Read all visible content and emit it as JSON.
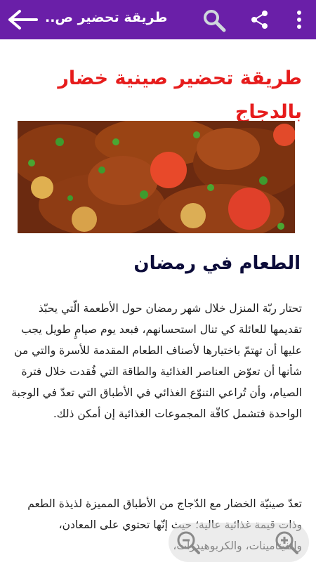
{
  "appbar": {
    "title": "طريقة تحضير ص..",
    "back_icon": "arrow-back-icon",
    "search_icon": "search-icon",
    "share_icon": "share-icon",
    "more_icon": "more-vert-icon",
    "color": "#6a1fa8"
  },
  "article": {
    "title": "طريقة تحضير صينية خضار بالدجاج",
    "title_color": "#e61c1c",
    "section_title": "الطعام في رمضان",
    "paragraph_1": "تحتار ربّة المنزل خلال شهر رمضان حول الأطعمة الّتي يحبّذ تقديمها للعائلة كي تنال استحسانهم، فبعد يوم صيامٍ طويل يجب عليها أن تهتمّ باختيارها لأصناف الطعام المقدمة للأسرة والتي من شأنها أن تعوّض العناصر الغذائية والطاقة التي فُقدت خلال فترة الصيام، وأن تُراعي التنوّع الغذائي في الأطباق التي تعدّ في الوجبة الواحدة فتشمل كافّة المجموعات الغذائية إن أمكن ذلك.",
    "paragraph_2": "تعدّ صينيّة الخضار مع الدّجاج من الأطباق المميزة لذيذة الطعم وذات قيمة غذائية عالية؛ حيث إنّها تحتوي على المعادن، والفيتامينات، والكربوهيدرات،"
  },
  "zoom": {
    "zoom_out_icon": "zoom-out-icon",
    "zoom_in_icon": "zoom-in-icon"
  }
}
